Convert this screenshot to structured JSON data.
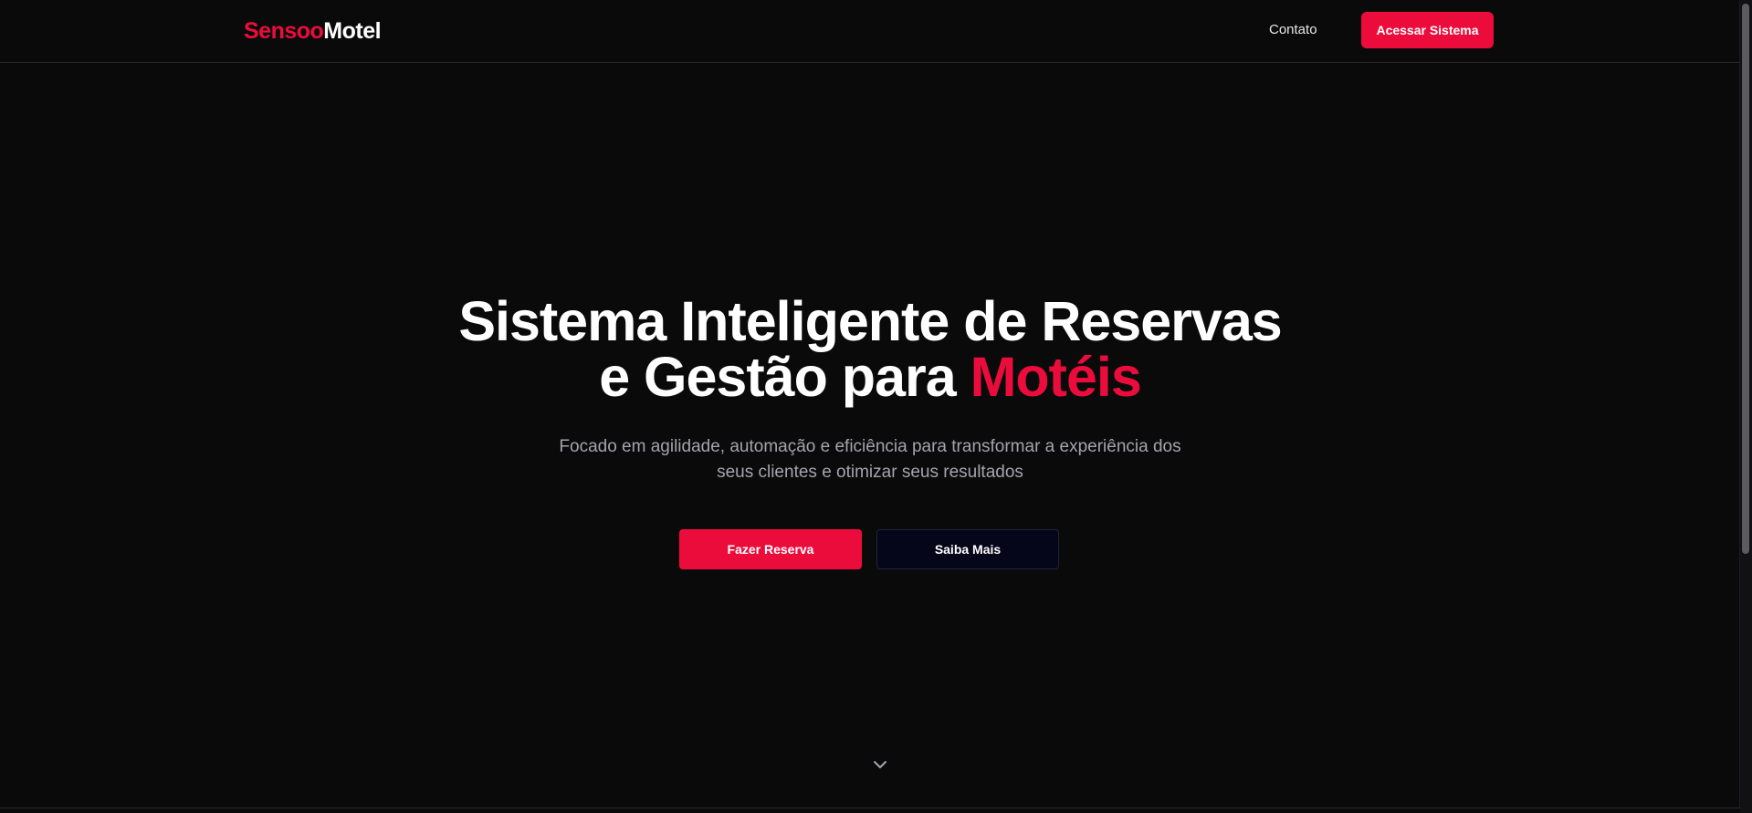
{
  "navbar": {
    "logo_accent": "Sensoo",
    "logo_rest": "Motel",
    "contact_label": "Contato",
    "cta_label": "Acessar Sistema"
  },
  "hero": {
    "title_line1": "Sistema Inteligente de Reservas",
    "title_line2_prefix": "e Gestão para ",
    "title_line2_highlight": "Motéis",
    "subtitle": "Focado em agilidade, automação e eficiência para transformar a experiência dos seus clientes e otimizar seus resultados",
    "primary_button": "Fazer Reserva",
    "secondary_button": "Saiba Mais",
    "scroll_icon": "chevron-down-icon"
  },
  "colors": {
    "accent": "#ec0c3c",
    "background": "#0a0a0b",
    "text": "#ffffff",
    "muted_text": "#a4a4ab",
    "secondary_button_bg": "#06061a"
  }
}
